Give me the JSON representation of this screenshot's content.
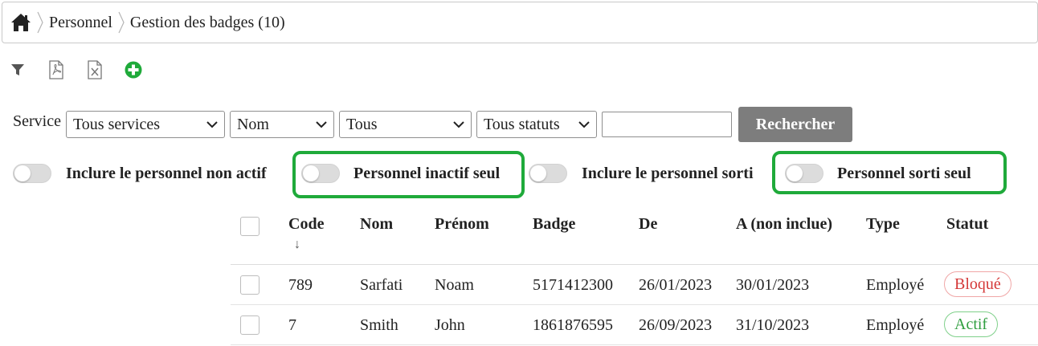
{
  "breadcrumb": {
    "home_icon": "home-icon",
    "items": [
      "Personnel",
      "Gestion des badges (10)"
    ]
  },
  "toolbar": {
    "icons": [
      "filter-icon",
      "pdf-export-icon",
      "excel-export-icon",
      "add-circle-icon"
    ],
    "accent": "#1faa3a"
  },
  "filters": {
    "service_label": "Service",
    "service_value": "Tous services",
    "field_value": "Nom",
    "scope_value": "Tous",
    "status_value": "Tous statuts",
    "search_value": "",
    "search_button": "Rechercher"
  },
  "toggles": [
    {
      "label": "Inclure le personnel non actif",
      "on": false
    },
    {
      "label": "Personnel inactif seul",
      "on": false,
      "highlighted": true
    },
    {
      "label": "Inclure le personnel sorti",
      "on": false
    },
    {
      "label": "Personnel sorti seul",
      "on": false,
      "highlighted": true
    }
  ],
  "table": {
    "columns": [
      "Code",
      "Nom",
      "Prénom",
      "Badge",
      "De",
      "A (non inclue)",
      "Type",
      "Statut"
    ],
    "sort_indicator": "↓",
    "rows": [
      {
        "code": "789",
        "nom": "Sarfati",
        "prenom": "Noam",
        "badge": "5171412300",
        "de": "26/01/2023",
        "a": "30/01/2023",
        "type": "Employé",
        "statut": "Bloqué"
      },
      {
        "code": "7",
        "nom": "Smith",
        "prenom": "John",
        "badge": "1861876595",
        "de": "26/09/2023",
        "a": "31/10/2023",
        "type": "Employé",
        "statut": "Actif"
      }
    ]
  },
  "colors": {
    "highlight": "#1faa3a",
    "blocked": "#d43838",
    "active": "#2f9e3f",
    "button_bg": "#7d7d7d"
  }
}
